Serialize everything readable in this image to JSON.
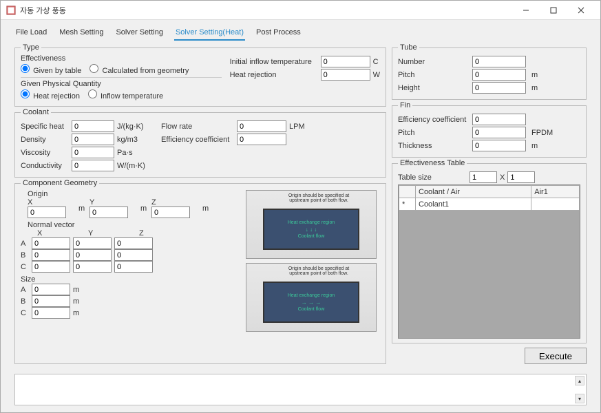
{
  "window": {
    "title": "자동 가상 풍동"
  },
  "tabs": [
    {
      "label": "File Load"
    },
    {
      "label": "Mesh Setting"
    },
    {
      "label": "Solver Setting"
    },
    {
      "label": "Solver Setting(Heat)",
      "active": true
    },
    {
      "label": "Post Process"
    }
  ],
  "type": {
    "legend": "Type",
    "effectiveness_label": "Effectiveness",
    "given_by_table": "Given by table",
    "calc_from_geom": "Calculated from geometry",
    "given_phys_label": "Given Physical Quantity",
    "heat_rejection": "Heat rejection",
    "inflow_temp": "Inflow temperature",
    "initial_inflow_label": "Initial inflow temperature",
    "initial_inflow_val": "0",
    "initial_inflow_unit": "C",
    "heat_rej_label": "Heat rejection",
    "heat_rej_val": "0",
    "heat_rej_unit": "W"
  },
  "coolant": {
    "legend": "Coolant",
    "specific_heat": {
      "label": "Specific heat",
      "val": "0",
      "unit": "J/(kg·K)"
    },
    "density": {
      "label": "Density",
      "val": "0",
      "unit": "kg/m3"
    },
    "viscosity": {
      "label": "Viscosity",
      "val": "0",
      "unit": "Pa·s"
    },
    "conductivity": {
      "label": "Conductivity",
      "val": "0",
      "unit": "W/(m·K)"
    },
    "flow_rate": {
      "label": "Flow rate",
      "val": "0",
      "unit": "LPM"
    },
    "eff_coef": {
      "label": "Efficiency coefficient",
      "val": "0"
    }
  },
  "geom": {
    "legend": "Component Geometry",
    "origin_label": "Origin",
    "x": "X",
    "y": "Y",
    "z": "Z",
    "origin_x": "0",
    "origin_y": "0",
    "origin_z": "0",
    "unit_m": "m",
    "normal_label": "Normal vector",
    "a": "A",
    "b": "B",
    "c": "C",
    "na_x": "0",
    "na_y": "0",
    "na_z": "0",
    "nb_x": "0",
    "nb_y": "0",
    "nb_z": "0",
    "nc_x": "0",
    "nc_y": "0",
    "nc_z": "0",
    "size_label": "Size",
    "size_a": "0",
    "size_b": "0",
    "size_c": "0",
    "diag_note": "Origin should be specified at upstream point of both flow.",
    "diag_t1": "Heat exchange region",
    "diag_t2": "Coolant flow"
  },
  "tube": {
    "legend": "Tube",
    "number": {
      "label": "Number",
      "val": "0"
    },
    "pitch": {
      "label": "Pitch",
      "val": "0",
      "unit": "m"
    },
    "height": {
      "label": "Height",
      "val": "0",
      "unit": "m"
    }
  },
  "fin": {
    "legend": "Fin",
    "eff": {
      "label": "Efficiency coefficient",
      "val": "0"
    },
    "pitch": {
      "label": "Pitch",
      "val": "0",
      "unit": "FPDM"
    },
    "thickness": {
      "label": "Thickness",
      "val": "0",
      "unit": "m"
    }
  },
  "eff_table": {
    "legend": "Effectiveness Table",
    "size_label": "Table size",
    "rows": "1",
    "x": "X",
    "cols": "1",
    "header1": "Coolant / Air",
    "header2": "Air1",
    "row_marker": "*",
    "cell1": "Coolant1"
  },
  "execute": "Execute"
}
